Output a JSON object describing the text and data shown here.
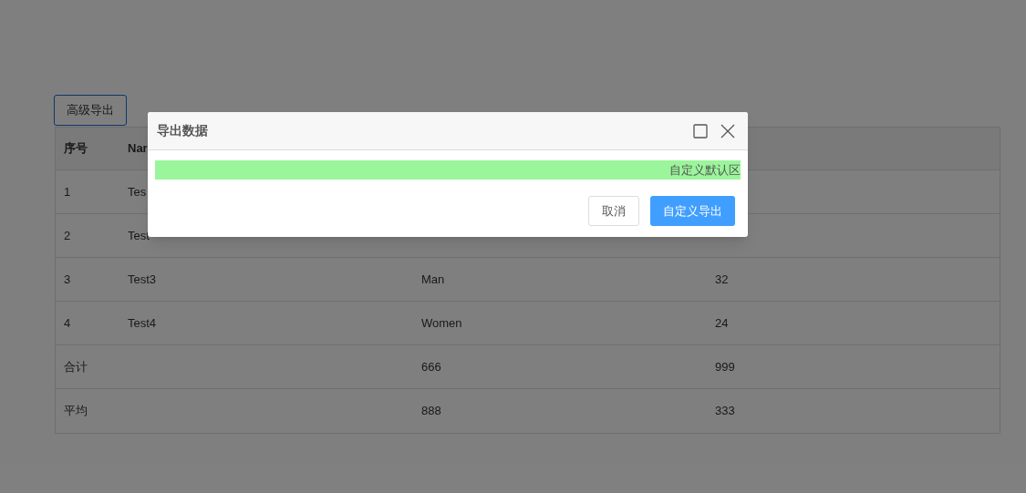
{
  "toolbar": {
    "export_button": "高级导出"
  },
  "table": {
    "columns": [
      "序号",
      "Nar"
    ],
    "rows": [
      [
        "1",
        "Tes",
        "",
        ""
      ],
      [
        "2",
        "Test",
        "",
        ""
      ],
      [
        "3",
        "Test3",
        "Man",
        "32"
      ],
      [
        "4",
        "Test4",
        "Women",
        "24"
      ],
      [
        "合计",
        "",
        "666",
        "999"
      ],
      [
        "平均",
        "",
        "888",
        "333"
      ]
    ]
  },
  "dialog": {
    "title": "导出数据",
    "default_area": "自定义默认区",
    "buttons": [
      {
        "label": "取消",
        "kind": "default"
      },
      {
        "label": "自定义导出",
        "kind": "primary"
      }
    ]
  }
}
